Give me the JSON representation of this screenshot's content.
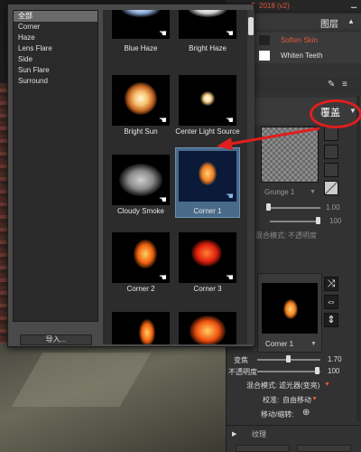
{
  "app": {
    "version_text": "2018 (v2)",
    "layers_label": "图层",
    "overlay_label": "覆盖"
  },
  "layers": [
    {
      "name": "Soften Skin",
      "color": "#e05a3a"
    },
    {
      "name": "Whiten Teeth",
      "color": "#d6d6d6"
    }
  ],
  "categories": [
    {
      "label": "全部",
      "selected": true
    },
    {
      "label": "Corner"
    },
    {
      "label": "Haze"
    },
    {
      "label": "Lens Flare"
    },
    {
      "label": "Side"
    },
    {
      "label": "Sun Flare"
    },
    {
      "label": "Surround"
    }
  ],
  "import_button": "导入...",
  "grid_items": [
    {
      "label": "Blue Haze"
    },
    {
      "label": "Bright Haze"
    },
    {
      "label": "Bright Sun"
    },
    {
      "label": "Center Light Source"
    },
    {
      "label": "Cloudy Smoke"
    },
    {
      "label": "Corner 1",
      "selected": true
    },
    {
      "label": "Corner 2"
    },
    {
      "label": "Corner 3"
    }
  ],
  "overlay_panel": {
    "texture_name": "Grunge 1",
    "value1": "1.00",
    "value2": "100",
    "blend_label": "混合模式:",
    "blend_value": "不透明度",
    "preview_name": "Corner 1"
  },
  "bottom_controls": {
    "transform_label": "变焦",
    "transform_value": "1.70",
    "opacity_label": "不透明度",
    "opacity_value": "100",
    "blend_label": "混合模式:",
    "blend_value": "滤光器(变亮)",
    "align_label": "校准:",
    "align_value": "自由移动",
    "move_label": "移动/缩转:"
  },
  "footer": {
    "layer_label": "纹理"
  }
}
